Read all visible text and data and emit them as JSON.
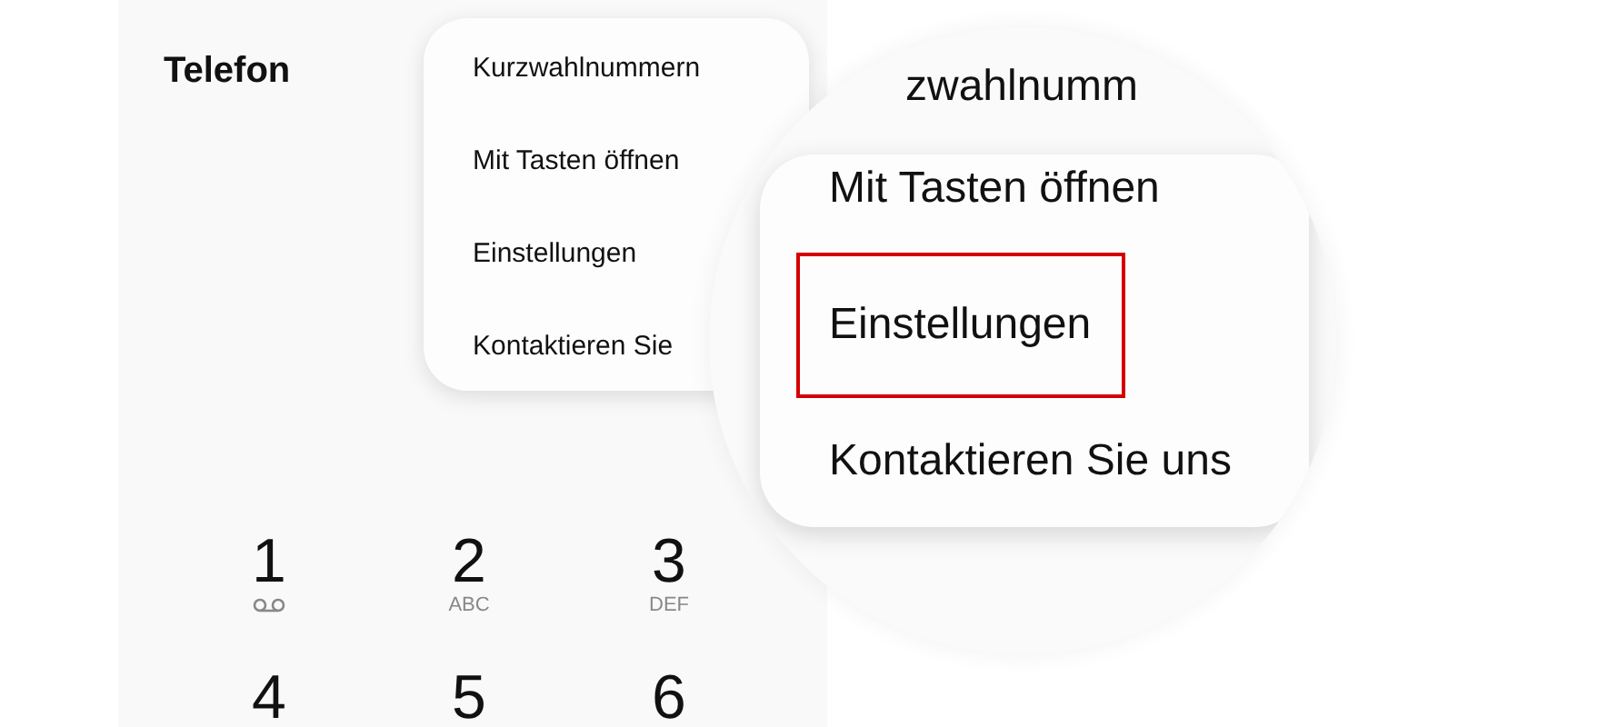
{
  "screen": {
    "title": "Telefon",
    "menu": {
      "items": [
        "Kurzwahlnummern",
        "Mit Tasten öffnen",
        "Einstellungen",
        "Kontaktieren Sie"
      ]
    },
    "keypad": [
      {
        "digit": "1",
        "kind": "voicemail"
      },
      {
        "digit": "2",
        "kind": "letters",
        "letters": "ABC"
      },
      {
        "digit": "3",
        "kind": "letters",
        "letters": "DEF"
      },
      {
        "digit": "4",
        "kind": "plain"
      },
      {
        "digit": "5",
        "kind": "plain"
      },
      {
        "digit": "6",
        "kind": "plain"
      }
    ]
  },
  "magnifier": {
    "partial_text": "zwahlnumm",
    "menu": {
      "items": [
        {
          "label": "Mit Tasten öffnen",
          "highlighted": false
        },
        {
          "label": "Einstellungen",
          "highlighted": true
        },
        {
          "label": "Kontaktieren Sie uns",
          "highlighted": false
        }
      ]
    }
  }
}
